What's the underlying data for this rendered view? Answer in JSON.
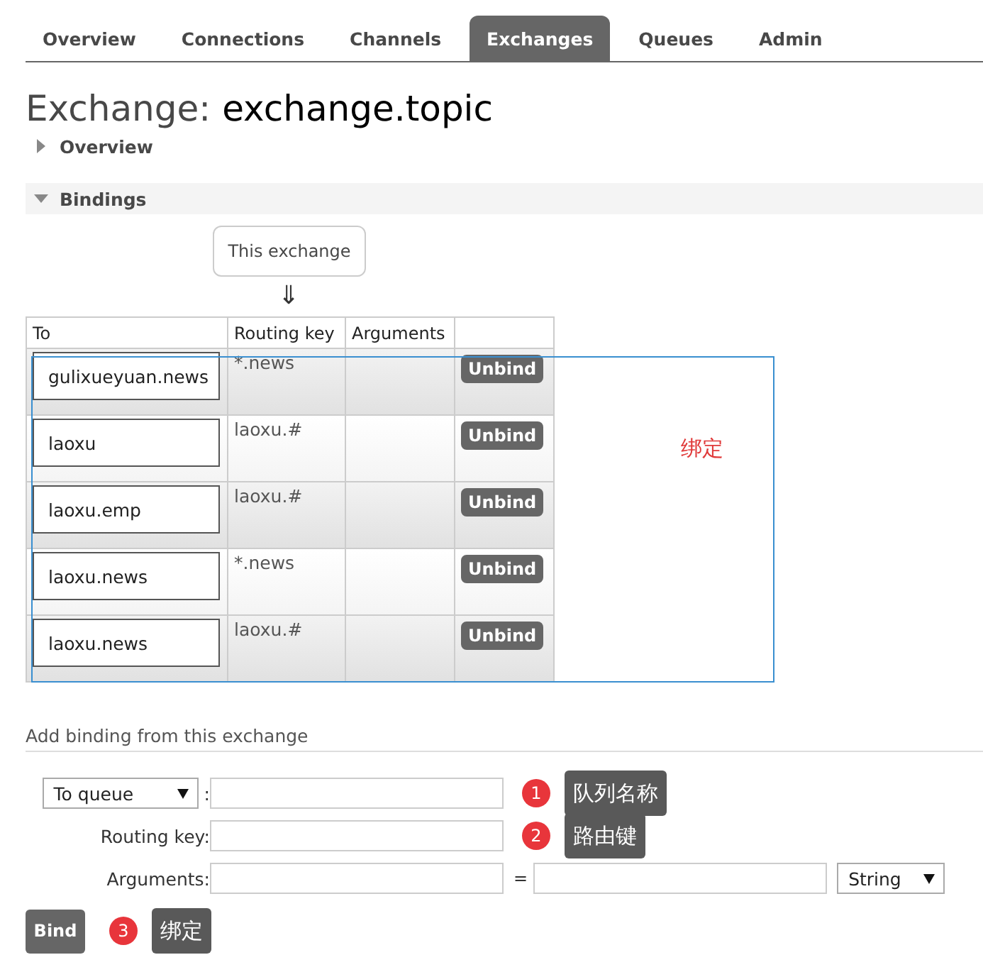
{
  "tabs": [
    {
      "label": "Overview",
      "selected": false
    },
    {
      "label": "Connections",
      "selected": false
    },
    {
      "label": "Channels",
      "selected": false
    },
    {
      "label": "Exchanges",
      "selected": true
    },
    {
      "label": "Queues",
      "selected": false
    },
    {
      "label": "Admin",
      "selected": false
    }
  ],
  "title": {
    "prefix": "Exchange:",
    "name": "exchange.topic"
  },
  "sections": [
    {
      "label": "Overview",
      "expanded": false
    },
    {
      "label": "Bindings",
      "expanded": true
    }
  ],
  "bindings": {
    "source": "This exchange",
    "arrow": "⇓",
    "columns": [
      "To",
      "Routing key",
      "Arguments"
    ],
    "rows": [
      {
        "to": "gulixueyuan.news",
        "routing_key": "*.news",
        "action": "Unbind"
      },
      {
        "to": "laoxu",
        "routing_key": "laoxu.#",
        "action": "Unbind"
      },
      {
        "to": "laoxu.emp",
        "routing_key": "laoxu.#",
        "action": "Unbind"
      },
      {
        "to": "laoxu.news",
        "routing_key": "*.news",
        "action": "Unbind"
      },
      {
        "to": "laoxu.news",
        "routing_key": "laoxu.#",
        "action": "Unbind"
      }
    ],
    "annotation": "绑定"
  },
  "add_binding": {
    "title": "Add binding from this exchange",
    "destination_type": "To queue",
    "colon": ":",
    "routing_key_label": "Routing key:",
    "arguments_label": "Arguments:",
    "equals": "=",
    "argument_type": "String",
    "bind_button": "Bind"
  },
  "callouts": [
    {
      "number": "1",
      "text": "队列名称"
    },
    {
      "number": "2",
      "text": "路由键"
    },
    {
      "number": "3",
      "text": "绑定"
    }
  ]
}
